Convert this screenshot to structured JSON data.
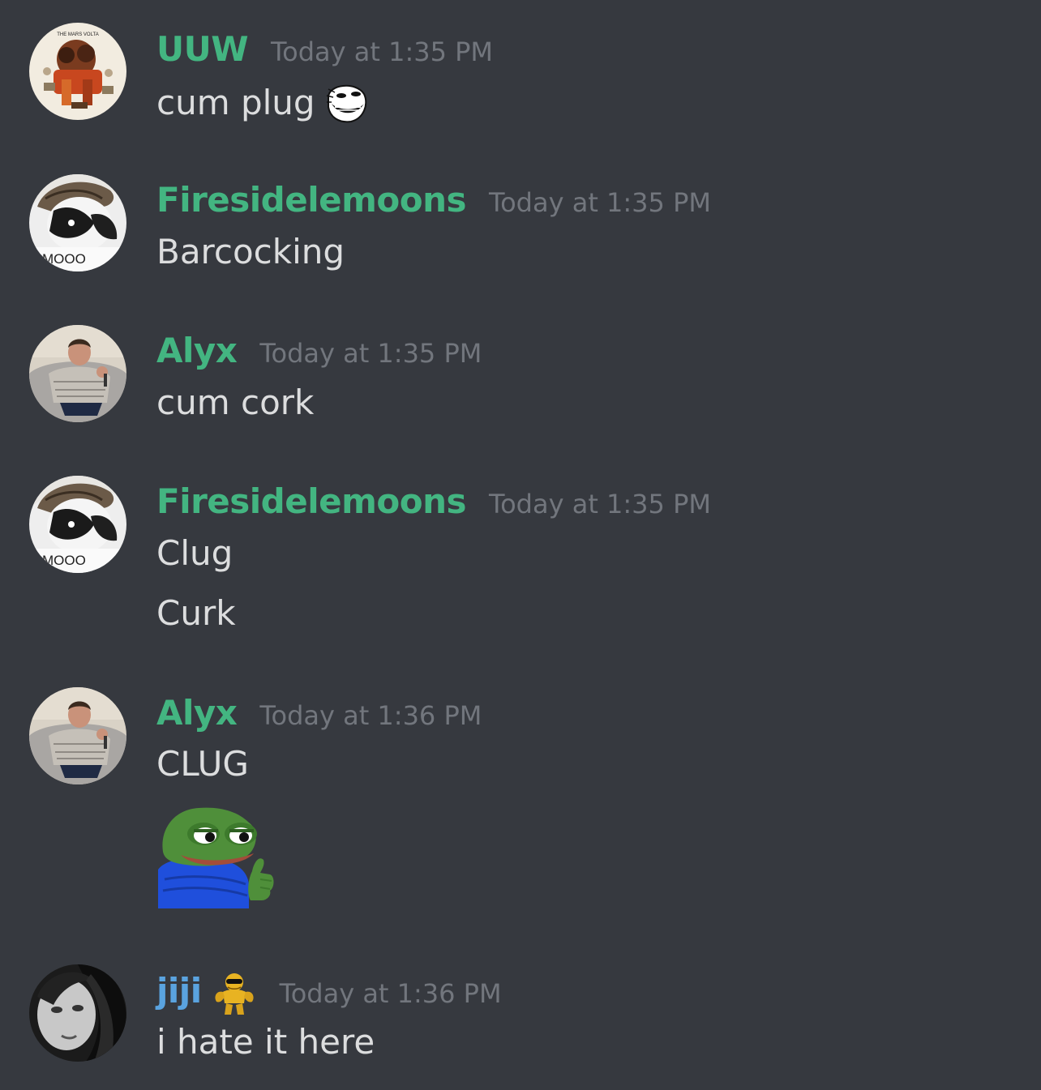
{
  "messages": [
    {
      "username": "UUW",
      "timestamp": "Today at 1:35 PM",
      "lines": [
        "cum plug"
      ],
      "avatar": "mars-volta-album-avatar",
      "inline_emoji": "trollface-emoji"
    },
    {
      "username": "Firesidelemoons",
      "timestamp": "Today at 1:35 PM",
      "lines": [
        "Barcocking"
      ],
      "avatar": "cow-moooo-avatar"
    },
    {
      "username": "Alyx",
      "timestamp": "Today at 1:35 PM",
      "lines": [
        "cum cork"
      ],
      "avatar": "person-on-couch-avatar"
    },
    {
      "username": "Firesidelemoons",
      "timestamp": "Today at 1:35 PM",
      "lines": [
        "Clug",
        "Curk"
      ],
      "avatar": "cow-moooo-avatar"
    },
    {
      "username": "Alyx",
      "timestamp": "Today at 1:36 PM",
      "lines": [
        "CLUG"
      ],
      "avatar": "person-on-couch-avatar",
      "sticker": "pepe-thumbs-up-emoji"
    },
    {
      "username": "jiji",
      "timestamp": "Today at 1:36 PM",
      "lines": [
        "i hate it here"
      ],
      "avatar": "bw-selfie-avatar",
      "name_badge": "buff-emoji-sunglasses"
    }
  ],
  "avatar_text": {
    "album_title": "THE MARS VOLTA",
    "cow_caption": "MOOO"
  },
  "colors": {
    "background": "#36393f",
    "message_text": "#dcddde",
    "timestamp": "#72767d",
    "username_green": "#43b581",
    "username_blue": "#5aa3df"
  }
}
